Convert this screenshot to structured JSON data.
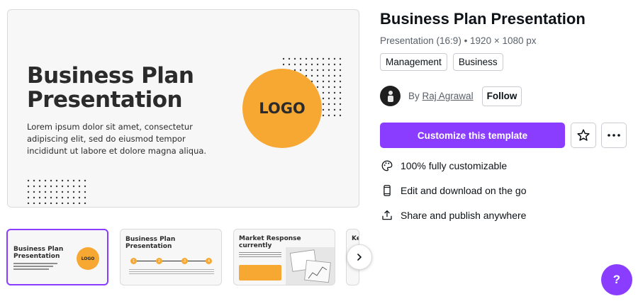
{
  "preview": {
    "slide_title": "Business Plan Presentation",
    "slide_body": "Lorem ipsum dolor sit amet, consectetur adipiscing elit, sed do eiusmod tempor incididunt ut labore et dolore magna aliqua.",
    "logo_text": "LOGO"
  },
  "thumbnails": [
    {
      "title": "Business Plan Presentation",
      "logo_text": "LOGO",
      "selected": true
    },
    {
      "title": "Business Plan Presentation",
      "steps": [
        "1",
        "2",
        "3",
        "4"
      ]
    },
    {
      "title": "Market Response currently"
    },
    {
      "title": "Ke"
    }
  ],
  "template": {
    "title": "Business Plan Presentation",
    "meta": "Presentation (16:9) • 1920 × 1080 px",
    "tags": [
      "Management",
      "Business"
    ],
    "author_prefix": "By",
    "author_name": "Raj Agrawal",
    "follow_label": "Follow",
    "cta_label": "Customize this template"
  },
  "features": [
    {
      "icon": "palette-icon",
      "label": "100% fully customizable"
    },
    {
      "icon": "phone-icon",
      "label": "Edit and download on the go"
    },
    {
      "icon": "share-icon",
      "label": "Share and publish anywhere"
    }
  ],
  "help_label": "?",
  "colors": {
    "accent": "#8b3dff",
    "logo_orange": "#f7a832"
  }
}
